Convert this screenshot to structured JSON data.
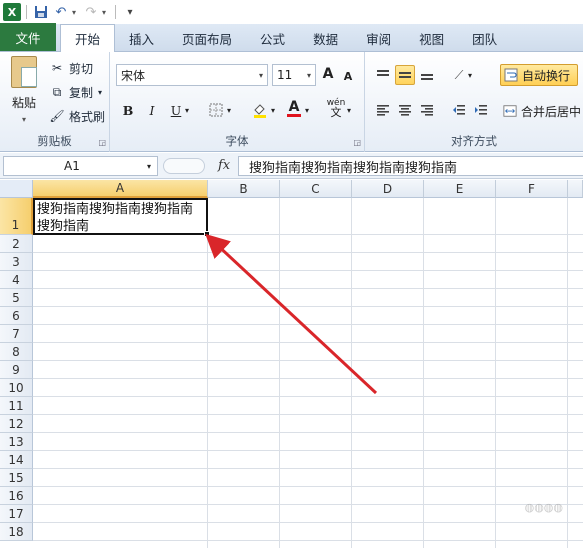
{
  "quick_access": {
    "app_icon": "X",
    "icons": [
      "save-icon",
      "undo-icon",
      "redo-icon",
      "customize-icon"
    ]
  },
  "tabs": [
    {
      "label": "文件"
    },
    {
      "label": "开始"
    },
    {
      "label": "插入"
    },
    {
      "label": "页面布局"
    },
    {
      "label": "公式"
    },
    {
      "label": "数据"
    },
    {
      "label": "审阅"
    },
    {
      "label": "视图"
    },
    {
      "label": "团队"
    }
  ],
  "ribbon": {
    "clipboard": {
      "paste_label": "粘贴",
      "cut_label": "剪切",
      "copy_label": "复制",
      "format_painter_label": "格式刷",
      "group_label": "剪贴板"
    },
    "font": {
      "font_name": "宋体",
      "font_size": "11",
      "grow_label": "A",
      "shrink_label": "A",
      "bold": "B",
      "italic": "I",
      "underline": "U",
      "font_color_glyph": "A",
      "wen_glyph": "wén",
      "group_label": "字体"
    },
    "alignment": {
      "wrap_label": "自动换行",
      "merge_label": "合并后居中",
      "group_label": "对齐方式"
    }
  },
  "formula_bar": {
    "name_box": "A1",
    "fx": "fx",
    "content": "搜狗指南搜狗指南搜狗指南搜狗指南"
  },
  "grid": {
    "columns": [
      "A",
      "B",
      "C",
      "D",
      "E",
      "F"
    ],
    "rows": [
      "1",
      "2",
      "3",
      "4",
      "5",
      "6",
      "7",
      "8",
      "9",
      "10",
      "11",
      "12",
      "13",
      "14",
      "15",
      "16",
      "17",
      "18"
    ],
    "cell_a1": "搜狗指南搜狗指南搜狗指南搜狗指南"
  },
  "colors": {
    "file_tab": "#2c7a3f",
    "selection_header": "#f6cf6e",
    "arrow": "#d9262a"
  }
}
